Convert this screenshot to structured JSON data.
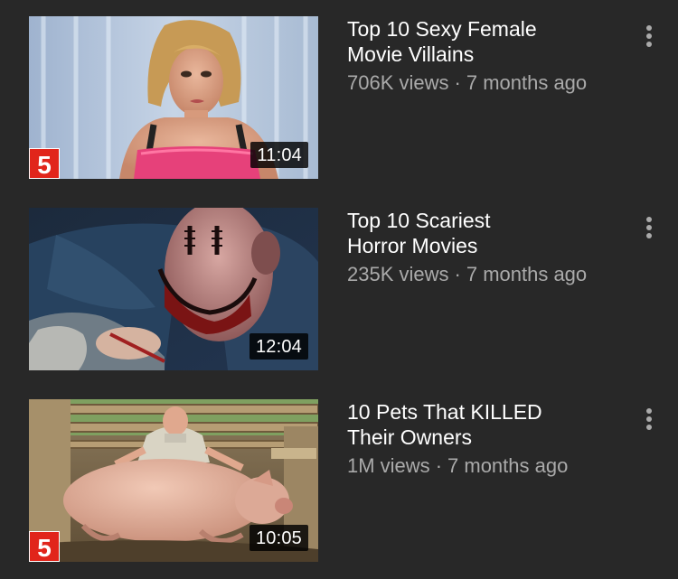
{
  "videos": [
    {
      "title_line1": "Top 10 Sexy Female",
      "title_line2": "Movie Villains",
      "views": "706K views",
      "separator": "·",
      "age": "7 months ago",
      "duration": "11:04",
      "badge": "5"
    },
    {
      "title_line1": "Top 10 Scariest",
      "title_line2": "Horror Movies",
      "views": "235K views",
      "separator": "·",
      "age": "7 months ago",
      "duration": "12:04"
    },
    {
      "title_line1": "10 Pets That KILLED",
      "title_line2": "Their Owners",
      "views": "1M views",
      "separator": "·",
      "age": "7 months ago",
      "duration": "10:05",
      "badge": "5"
    }
  ],
  "colors": {
    "background": "#282828",
    "title": "#ffffff",
    "meta": "#aaaaaa",
    "badge_red": "#e1251b",
    "duration_bg": "#000000"
  },
  "icons": {
    "menu": "more-vert-icon"
  }
}
